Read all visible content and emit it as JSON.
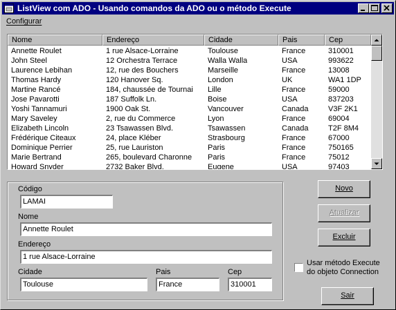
{
  "window": {
    "title": "ListView com ADO  - Usando comandos da ADO ou o método Execute"
  },
  "menu": {
    "configurar_label": "Configurar"
  },
  "listview": {
    "columns": [
      "Nome",
      "Endereço",
      "Cidade",
      "Pais",
      "Cep"
    ],
    "rows": [
      [
        "Annette Roulet",
        "1 rue Alsace-Lorraine",
        "Toulouse",
        "France",
        "310001"
      ],
      [
        "John Steel",
        "12 Orchestra Terrace",
        "Walla Walla",
        "USA",
        "993622"
      ],
      [
        "Laurence Lebihan",
        "12, rue des Bouchers",
        "Marseille",
        "France",
        "13008"
      ],
      [
        "Thomas Hardy",
        "120 Hanover Sq.",
        "London",
        "UK",
        "WA1 1DP"
      ],
      [
        "Martine Rancé",
        "184, chaussée de Tournai",
        "Lille",
        "France",
        "59000"
      ],
      [
        "Jose Pavarotti",
        "187 Suffolk Ln.",
        "Boise",
        "USA",
        "837203"
      ],
      [
        "Yoshi Tannamuri",
        "1900 Oak St.",
        "Vancouver",
        "Canada",
        "V3F 2K1"
      ],
      [
        "Mary Saveley",
        "2, rue du Commerce",
        "Lyon",
        "France",
        "69004"
      ],
      [
        "Elizabeth Lincoln",
        "23 Tsawassen Blvd.",
        "Tsawassen",
        "Canada",
        "T2F 8M4"
      ],
      [
        "Frédérique Citeaux",
        "24, place Kléber",
        "Strasbourg",
        "France",
        "67000"
      ],
      [
        "Dominique Perrier",
        "25, rue Lauriston",
        "Paris",
        "France",
        "750165"
      ],
      [
        "Marie Bertrand",
        "265, boulevard Charonne",
        "Paris",
        "France",
        "75012"
      ],
      [
        "Howard Snyder",
        "2732 Baker Blvd.",
        "Eugene",
        "USA",
        "97403"
      ]
    ]
  },
  "form": {
    "codigo_label": "Código",
    "codigo_value": "LAMAI",
    "nome_label": "Nome",
    "nome_value": "Annette Roulet",
    "endereco_label": "Endereço",
    "endereco_value": "1 rue Alsace-Lorraine",
    "cidade_label": "Cidade",
    "cidade_value": "Toulouse",
    "pais_label": "Pais",
    "pais_value": "France",
    "cep_label": "Cep",
    "cep_value": "310001"
  },
  "buttons": {
    "novo": "Novo",
    "atualizar": "Atualizar",
    "excluir": "Excluir",
    "sair": "Sair"
  },
  "checkbox": {
    "line1": "Usar método Execute",
    "line2": "do objeto Connection",
    "checked": false
  }
}
